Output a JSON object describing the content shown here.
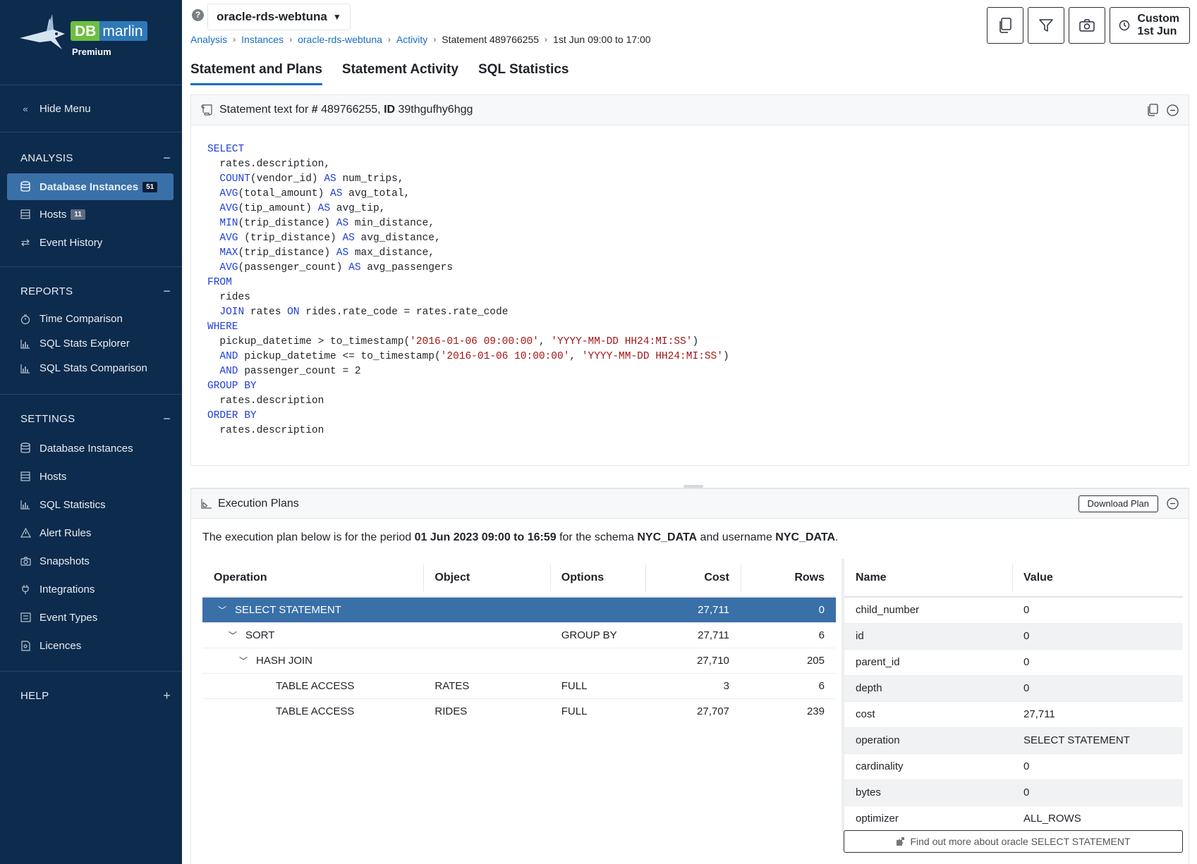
{
  "brand": {
    "db": "DB",
    "marlin": "marlin",
    "tier": "Premium"
  },
  "sidebar": {
    "hide_menu": "Hide Menu",
    "sections": [
      {
        "title": "ANALYSIS",
        "toggle": "−"
      },
      {
        "title": "REPORTS",
        "toggle": "−"
      },
      {
        "title": "SETTINGS",
        "toggle": "−"
      },
      {
        "title": "HELP",
        "toggle": "+"
      }
    ],
    "analysis": [
      {
        "label": "Database Instances",
        "badge": "51"
      },
      {
        "label": "Hosts",
        "badge": "11"
      },
      {
        "label": "Event History"
      }
    ],
    "reports": [
      {
        "label": "Time Comparison"
      },
      {
        "label": "SQL Stats Explorer"
      },
      {
        "label": "SQL Stats Comparison"
      }
    ],
    "settings": [
      {
        "label": "Database Instances"
      },
      {
        "label": "Hosts"
      },
      {
        "label": "SQL Statistics"
      },
      {
        "label": "Alert Rules"
      },
      {
        "label": "Snapshots"
      },
      {
        "label": "Integrations"
      },
      {
        "label": "Event Types"
      },
      {
        "label": "Licences"
      }
    ]
  },
  "header": {
    "instance": "oracle-rds-webtuna",
    "breadcrumb": [
      "Analysis",
      "Instances",
      "oracle-rds-webtuna",
      "Activity",
      "Statement 489766255",
      "1st Jun 09:00 to 17:00"
    ],
    "custom_line1": "Custom",
    "custom_line2": "1st Jun"
  },
  "tabs": [
    "Statement and Plans",
    "Statement Activity",
    "SQL Statistics"
  ],
  "statement": {
    "head_prefix": "Statement text for ",
    "hash_label": "#",
    "number": " 489766255, ",
    "id_label": "ID",
    "id_value": " 39thgufhy6hgg"
  },
  "plans": {
    "title": "Execution Plans",
    "download": "Download Plan",
    "desc_1": "The execution plan below is for the period ",
    "period": "01 Jun 2023 09:00 to 16:59",
    "desc_2": " for the schema ",
    "schema": "NYC_DATA",
    "desc_3": " and username ",
    "username": "NYC_DATA",
    "desc_4": ".",
    "columns": [
      "Operation",
      "Object",
      "Options",
      "Cost",
      "Rows"
    ],
    "rows": [
      {
        "operation": "SELECT STATEMENT",
        "object": "",
        "options": "",
        "cost": "27,711",
        "rows": "0"
      },
      {
        "operation": "SORT",
        "object": "",
        "options": "GROUP BY",
        "cost": "27,711",
        "rows": "6"
      },
      {
        "operation": "HASH JOIN",
        "object": "",
        "options": "",
        "cost": "27,710",
        "rows": "205"
      },
      {
        "operation": "TABLE ACCESS",
        "object": "RATES",
        "options": "FULL",
        "cost": "3",
        "rows": "6"
      },
      {
        "operation": "TABLE ACCESS",
        "object": "RIDES",
        "options": "FULL",
        "cost": "27,707",
        "rows": "239"
      }
    ],
    "prop_columns": [
      "Name",
      "Value"
    ],
    "props": [
      {
        "name": "child_number",
        "value": "0"
      },
      {
        "name": "id",
        "value": "0"
      },
      {
        "name": "parent_id",
        "value": "0"
      },
      {
        "name": "depth",
        "value": "0"
      },
      {
        "name": "cost",
        "value": "27,711"
      },
      {
        "name": "operation",
        "value": "SELECT STATEMENT"
      },
      {
        "name": "cardinality",
        "value": "0"
      },
      {
        "name": "bytes",
        "value": "0"
      },
      {
        "name": "optimizer",
        "value": "ALL_ROWS"
      }
    ],
    "find_more": "Find out more about oracle SELECT STATEMENT"
  }
}
